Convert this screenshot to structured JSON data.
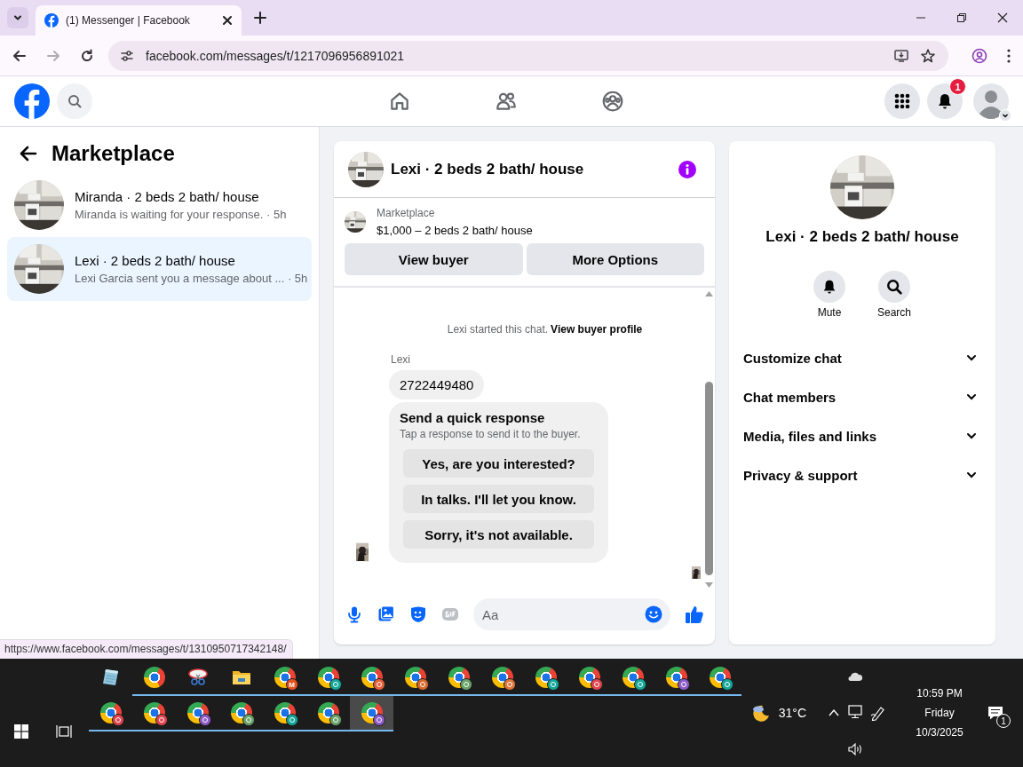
{
  "browser": {
    "tab": {
      "title": "(1) Messenger | Facebook",
      "selected": true
    },
    "url": "facebook.com/messages/t/1217096956891021",
    "forward_disabled": true,
    "status_url": "https://www.facebook.com/messages/t/1310950717342148/"
  },
  "header": {
    "notification_count": "1"
  },
  "sidebar": {
    "title": "Marketplace",
    "conversations": [
      {
        "name": "Miranda · 2 beds 2 bath/ house",
        "preview": "Miranda is waiting for your response. · 5h",
        "selected": false
      },
      {
        "name": "Lexi · 2 beds 2 bath/ house",
        "preview": "Lexi Garcia sent you a message about ... · 5h",
        "selected": true
      }
    ]
  },
  "chat": {
    "title": "Lexi · 2 beds 2 bath/ house",
    "listing": {
      "label": "Marketplace",
      "title": "$1,000 – 2 beds 2 bath/ house"
    },
    "buttons": [
      "View buyer",
      "More Options"
    ],
    "system_note": {
      "text": "Lexi started this chat.",
      "link": "View buyer profile"
    },
    "messages": [
      {
        "kind": "text",
        "sender": "Lexi",
        "text": "2722449480"
      },
      {
        "kind": "quick_responses",
        "title": "Send a quick response",
        "subtitle": "Tap a response to send it to the buyer.",
        "options": [
          "Yes, are you interested?",
          "In talks. I'll let you know.",
          "Sorry, it's not available."
        ]
      }
    ],
    "composer": {
      "placeholder": "Aa"
    }
  },
  "details": {
    "title": "Lexi · 2 beds 2 bath/ house",
    "actions": [
      {
        "kind": "mute",
        "label": "Mute"
      },
      {
        "kind": "search",
        "label": "Search"
      }
    ],
    "sections": [
      {
        "label": "Customize chat",
        "expanded": false
      },
      {
        "label": "Chat members",
        "expanded": false
      },
      {
        "label": "Media, files and links",
        "expanded": false
      },
      {
        "label": "Privacy & support",
        "expanded": false
      }
    ]
  },
  "taskbar": {
    "rows": [
      [
        {
          "kind": "notes",
          "running": false,
          "active": false
        },
        {
          "kind": "chrome",
          "running": true,
          "active": false
        },
        {
          "kind": "snip",
          "running": true,
          "active": false
        },
        {
          "kind": "folder",
          "running": true,
          "active": false
        },
        {
          "kind": "profile",
          "badge": "M",
          "color": "#e8521e",
          "running": true,
          "active": false
        },
        {
          "kind": "profile",
          "color": "#14a89a",
          "running": true,
          "active": false
        },
        {
          "kind": "profile",
          "color": "#e8603c",
          "running": true,
          "active": false
        },
        {
          "kind": "profile",
          "color": "#d9682b",
          "running": true,
          "active": false
        },
        {
          "kind": "profile",
          "color": "#6aa36a",
          "running": true,
          "active": false
        },
        {
          "kind": "profile",
          "color": "#e0763c",
          "running": true,
          "active": false
        },
        {
          "kind": "profile",
          "color": "#14a89a",
          "running": true,
          "active": false
        },
        {
          "kind": "profile",
          "color": "#e0454f",
          "running": true,
          "active": false
        },
        {
          "kind": "profile",
          "color": "#14a89a",
          "running": true,
          "active": false
        },
        {
          "kind": "profile",
          "color": "#8e5cc8",
          "running": true,
          "active": false
        },
        {
          "kind": "profile",
          "color": "#14a89a",
          "running": true,
          "active": false
        }
      ],
      [
        {
          "kind": "profile",
          "color": "#e0454f",
          "running": true,
          "active": false
        },
        {
          "kind": "profile",
          "color": "#e0454f",
          "running": true,
          "active": false
        },
        {
          "kind": "profile",
          "color": "#8e5cc8",
          "running": true,
          "active": false
        },
        {
          "kind": "profile",
          "color": "#6aa36a",
          "running": true,
          "active": false
        },
        {
          "kind": "profile",
          "color": "#14a89a",
          "running": true,
          "active": false
        },
        {
          "kind": "profile",
          "color": "#6aa36a",
          "running": true,
          "active": false
        },
        {
          "kind": "profile",
          "color": "#8e5cc8",
          "running": true,
          "active": true
        }
      ]
    ],
    "weather": "31°C",
    "time": "10:59 PM",
    "day": "Friday",
    "date": "10/3/2025",
    "notifications": "1"
  }
}
